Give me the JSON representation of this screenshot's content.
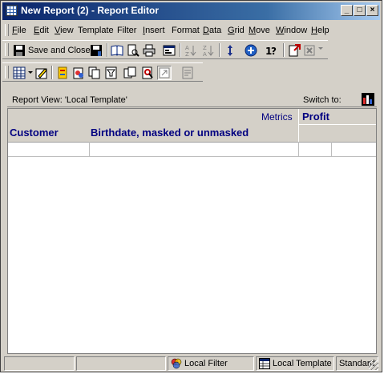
{
  "window": {
    "title": "New Report (2) - Report Editor"
  },
  "menu": {
    "items": [
      {
        "label": "File",
        "key": "F",
        "rest": "ile"
      },
      {
        "label": "Edit",
        "key": "E",
        "rest": "dit"
      },
      {
        "label": "View",
        "key": "V",
        "rest": "iew"
      },
      {
        "label": "Template",
        "key": "",
        "rest": "Template"
      },
      {
        "label": "Filter",
        "key": "",
        "rest": "Filter"
      },
      {
        "label": "Insert",
        "key": "I",
        "rest": "nsert"
      },
      {
        "label": "Format",
        "key": "",
        "rest": "Format"
      },
      {
        "label": "Data",
        "key": "D",
        "rest": "ata"
      },
      {
        "label": "Grid",
        "key": "G",
        "rest": "rid"
      },
      {
        "label": "Move",
        "key": "M",
        "rest": "ove"
      },
      {
        "label": "Window",
        "key": "W",
        "rest": "indow"
      },
      {
        "label": "Help",
        "key": "H",
        "rest": "elp"
      }
    ]
  },
  "toolbar": {
    "save_close_label": "Save and Close"
  },
  "report": {
    "view_label": "Report View: 'Local Template'",
    "switch_label": "Switch to:",
    "metrics_label": "Metrics",
    "profit_label": "Profit",
    "col_customer": "Customer",
    "col_birthdate": "Birthdate, masked or unmasked"
  },
  "status": {
    "local_filter": "Local Filter",
    "local_template": "Local Template",
    "mode": "Standard"
  },
  "colors": {
    "title_start": "#0a246a",
    "header_text": "#000080",
    "chrome": "#d4d0c8"
  }
}
